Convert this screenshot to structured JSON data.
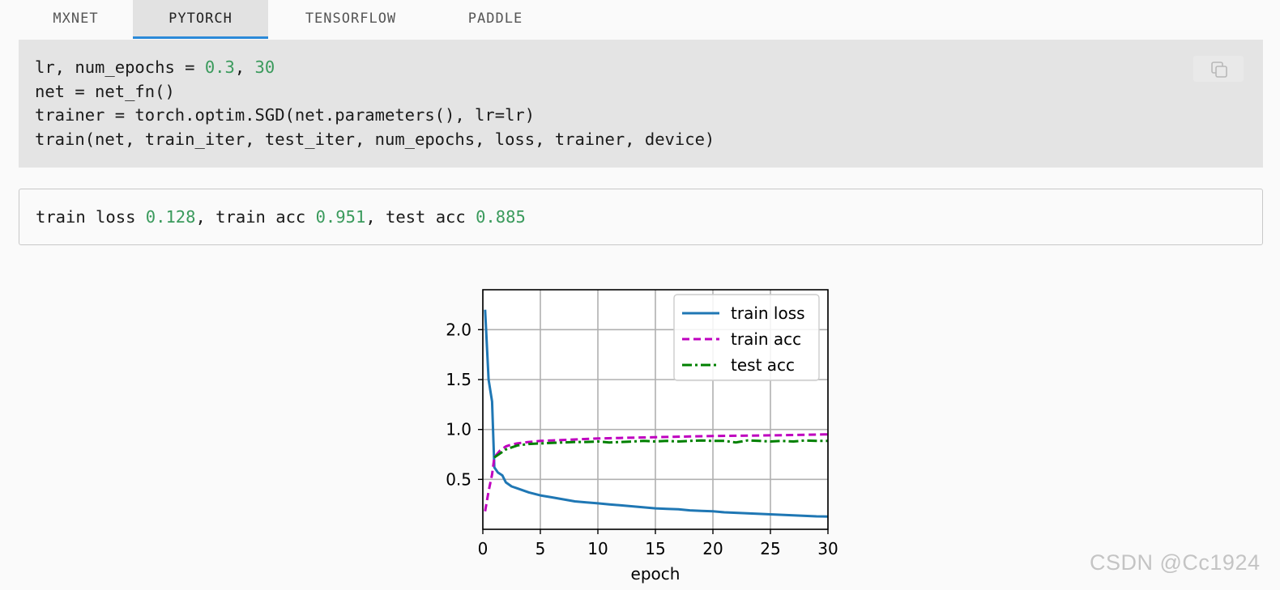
{
  "tabs": [
    {
      "label": "MXNET",
      "active": false
    },
    {
      "label": "PYTORCH",
      "active": true
    },
    {
      "label": "TENSORFLOW",
      "active": false
    },
    {
      "label": "PADDLE",
      "active": false
    }
  ],
  "code": {
    "line1": {
      "a": "lr, num_epochs = ",
      "n1": "0.3",
      "b": ", ",
      "n2": "30"
    },
    "line2": "net = net_fn()",
    "line3": "trainer = torch.optim.SGD(net.parameters(), lr=lr)",
    "line4": "train(net, train_iter, test_iter, num_epochs, loss, trainer, device)",
    "copy_icon": "copy-icon"
  },
  "output": {
    "p1": "train loss ",
    "v1": "0.128",
    "p2": ", train acc ",
    "v2": "0.951",
    "p3": ", test acc ",
    "v3": "0.885"
  },
  "watermark": "CSDN @Cc1924",
  "colors": {
    "accent": "#2b8ad8",
    "number": "#3a9a5c",
    "train_loss": "#1f77b4",
    "train_acc": "#bf00bf",
    "test_acc": "#008000"
  },
  "chart_data": {
    "type": "line",
    "xlabel": "epoch",
    "ylabel": "",
    "xlim": [
      0,
      30
    ],
    "ylim": [
      0.0,
      2.4
    ],
    "xticks": [
      0,
      5,
      10,
      15,
      20,
      25,
      30
    ],
    "yticks": [
      0.5,
      1.0,
      1.5,
      2.0
    ],
    "ytick_labels": [
      "0.5",
      "1.0",
      "1.5",
      "2.0"
    ],
    "grid": true,
    "legend_position": "top-right",
    "series": [
      {
        "name": "train loss",
        "style": "solid",
        "color": "#1f77b4",
        "x": [
          0.2,
          0.5,
          0.8,
          1.0,
          1.3,
          1.7,
          2.0,
          2.5,
          3,
          4,
          5,
          6,
          7,
          8,
          9,
          10,
          11,
          12,
          13,
          14,
          15,
          16,
          17,
          18,
          19,
          20,
          21,
          22,
          23,
          24,
          25,
          26,
          27,
          28,
          29,
          30
        ],
        "y": [
          2.2,
          1.5,
          1.28,
          0.62,
          0.57,
          0.54,
          0.47,
          0.43,
          0.41,
          0.37,
          0.34,
          0.32,
          0.3,
          0.28,
          0.27,
          0.26,
          0.25,
          0.24,
          0.23,
          0.22,
          0.21,
          0.205,
          0.2,
          0.19,
          0.185,
          0.18,
          0.17,
          0.165,
          0.16,
          0.155,
          0.15,
          0.145,
          0.14,
          0.135,
          0.13,
          0.128
        ]
      },
      {
        "name": "train acc",
        "style": "dashed",
        "color": "#bf00bf",
        "x": [
          0.2,
          0.5,
          0.8,
          1.0,
          1.5,
          2.0,
          2.5,
          3,
          4,
          5,
          6,
          7,
          8,
          9,
          10,
          12,
          14,
          16,
          18,
          20,
          22,
          24,
          26,
          28,
          30
        ],
        "y": [
          0.18,
          0.38,
          0.55,
          0.72,
          0.79,
          0.83,
          0.85,
          0.86,
          0.875,
          0.885,
          0.89,
          0.895,
          0.9,
          0.905,
          0.91,
          0.915,
          0.92,
          0.925,
          0.93,
          0.935,
          0.937,
          0.94,
          0.943,
          0.947,
          0.951
        ]
      },
      {
        "name": "test acc",
        "style": "dashdot",
        "color": "#008000",
        "x": [
          1.0,
          1.5,
          2.0,
          3,
          4,
          5,
          6,
          7,
          8,
          9,
          10,
          11,
          12,
          13,
          14,
          15,
          16,
          17,
          18,
          19,
          20,
          21,
          22,
          23,
          24,
          25,
          26,
          27,
          28,
          29,
          30
        ],
        "y": [
          0.72,
          0.76,
          0.8,
          0.84,
          0.855,
          0.86,
          0.865,
          0.87,
          0.875,
          0.875,
          0.88,
          0.87,
          0.875,
          0.88,
          0.885,
          0.88,
          0.885,
          0.88,
          0.885,
          0.89,
          0.885,
          0.885,
          0.87,
          0.89,
          0.885,
          0.88,
          0.885,
          0.88,
          0.89,
          0.885,
          0.885
        ]
      }
    ]
  }
}
